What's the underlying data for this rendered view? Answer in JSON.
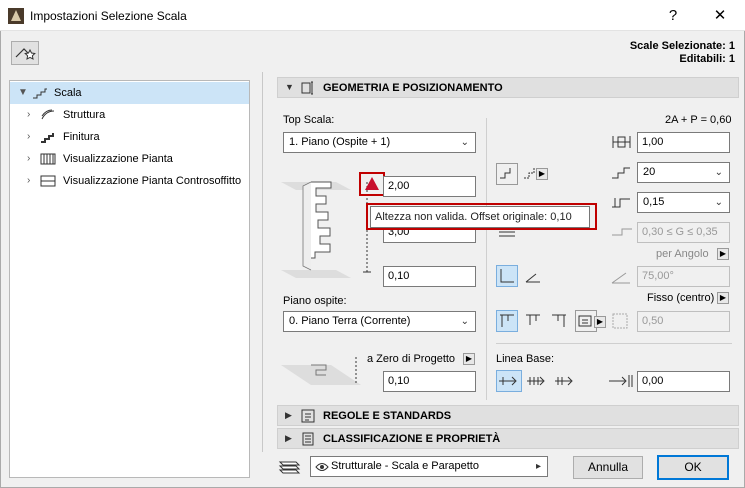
{
  "window": {
    "title": "Impostazioni Selezione Scala",
    "help": "?",
    "close": "✕"
  },
  "header": {
    "selected_label": "Scale Selezionate: 1",
    "editable_label": "Editabili: 1"
  },
  "tree": {
    "items": [
      {
        "label": "Scala",
        "selected": true
      },
      {
        "label": "Struttura"
      },
      {
        "label": "Finitura"
      },
      {
        "label": "Visualizzazione Pianta"
      },
      {
        "label": "Visualizzazione Pianta Controsoffitto"
      }
    ]
  },
  "sections": {
    "geometry": "GEOMETRIA E POSIZIONAMENTO",
    "rules": "REGOLE E STANDARDS",
    "classification": "CLASSIFICAZIONE E PROPRIETÀ"
  },
  "geometry": {
    "top_label": "Top Scala:",
    "top_value": "1. Piano (Ospite + 1)",
    "top_offset": "2,00",
    "height": "3,00",
    "base_offset": "0,10",
    "host_label": "Piano ospite:",
    "host_value": "0. Piano Terra (Corrente)",
    "zero_label": "a Zero di Progetto",
    "zero_value": "0,10",
    "tooltip": "Altezza non valida. Offset originale: 0,10",
    "formula": "2A + P = 0,60",
    "run_width": "1,00",
    "riser_count": "20",
    "riser_height": "0,15",
    "tread_range": "0,30 ≤ G ≤ 0,35",
    "angle_label": "per Angolo",
    "angle_value": "75,00°",
    "fixed_label": "Fisso (centro)",
    "fixed_value": "0,50",
    "baseline_label": "Linea Base:",
    "baseline_value": "0,00"
  },
  "footer": {
    "favorite": "Strutturale - Scala e Parapetto",
    "cancel": "Annulla",
    "ok": "OK"
  }
}
